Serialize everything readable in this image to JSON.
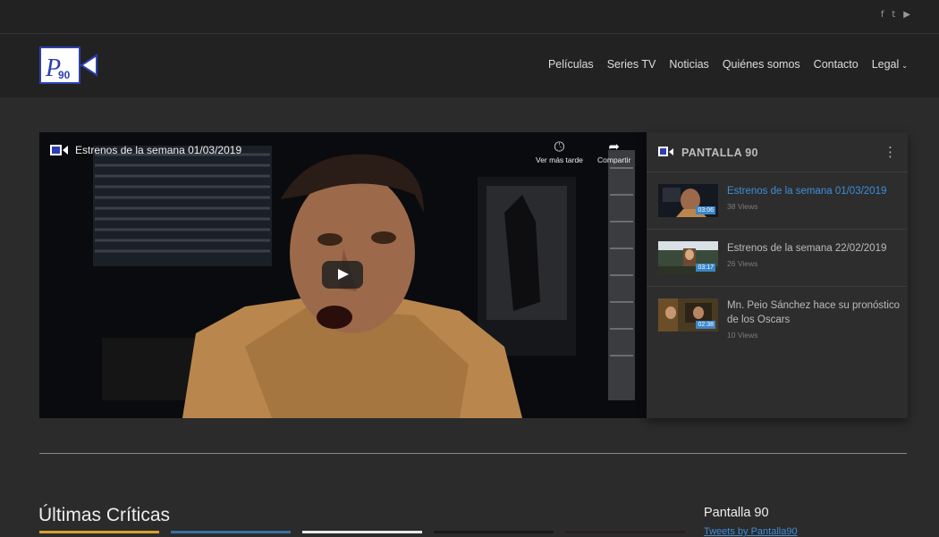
{
  "social": [
    "f",
    "t",
    "▶"
  ],
  "nav": [
    "Películas",
    "Series TV",
    "Noticias",
    "Quiénes somos",
    "Contacto",
    "Legal"
  ],
  "video": {
    "title": "Estrenos de la semana 01/03/2019",
    "watch_later": "Ver más tarde",
    "share": "Compartir"
  },
  "playlist": {
    "title": "PANTALLA 90",
    "items": [
      {
        "title": "Estrenos de la semana 01/03/2019",
        "views": "38 Views",
        "duration": "03:06",
        "active": true
      },
      {
        "title": "Estrenos de la semana 22/02/2019",
        "views": "26 Views",
        "duration": "03:17",
        "active": false
      },
      {
        "title": "Mn. Peio Sánchez hace su pronóstico de los Oscars",
        "views": "10 Views",
        "duration": "02:38",
        "active": false
      }
    ]
  },
  "section_title": "Últimas Críticas",
  "sidebar": {
    "title": "Pantalla 90",
    "link": "Tweets by Pantalla90"
  },
  "colors": {
    "accent": "#3d8fd8",
    "card_strips": [
      "#d6a12a",
      "#3b6ea8",
      "#e8e8e8",
      "#1a1a1a",
      "#2a2020"
    ]
  }
}
